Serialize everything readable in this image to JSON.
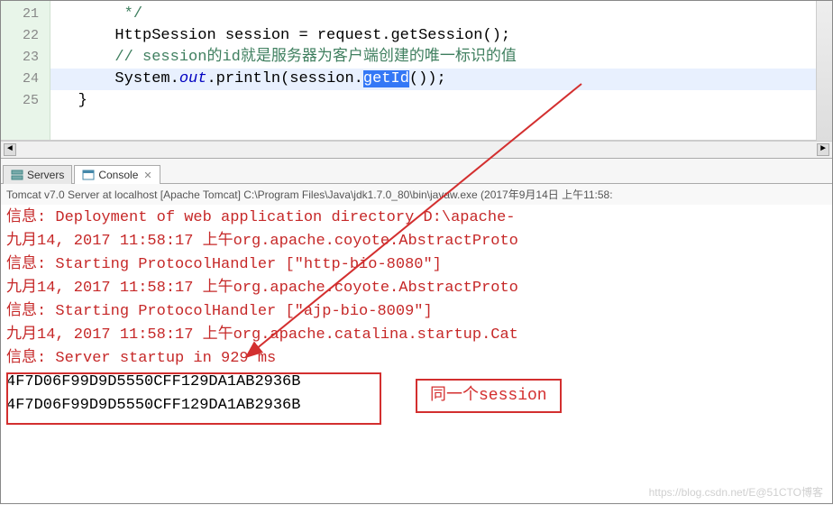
{
  "editor": {
    "lines": [
      {
        "num": "21",
        "content": "        */"
      },
      {
        "num": "22",
        "content": "       HttpSession session = request.getSession();"
      },
      {
        "num": "23",
        "content": "       // session的id就是服务器为客户端创建的唯一标识的值"
      },
      {
        "num": "24",
        "content": "       System.out.println(session.getId());"
      },
      {
        "num": "25",
        "content": "   }"
      }
    ],
    "code22": {
      "indent": "       ",
      "t1": "HttpSession session = request.getSession();"
    },
    "code23": {
      "indent": "       ",
      "comment": "// session的id就是服务器为客户端创建的唯一标识的值"
    },
    "code24": {
      "indent": "       ",
      "sys": "System.",
      "out": "out",
      "println": ".println(session.",
      "getId": "getId",
      "end": "());"
    },
    "code21": "        */",
    "code25": "   }"
  },
  "tabs": {
    "servers": "Servers",
    "console": "Console"
  },
  "consoleHeader": "Tomcat v7.0 Server at localhost [Apache Tomcat] C:\\Program Files\\Java\\jdk1.7.0_80\\bin\\javaw.exe (2017年9月14日 上午11:58:",
  "console": {
    "l1": "信息: Deployment of web application directory D:\\apache-",
    "l2": "九月14, 2017 11:58:17 上午org.apache.coyote.AbstractProto",
    "l3": "信息: Starting ProtocolHandler [\"http-bio-8080\"]",
    "l4": "九月14, 2017 11:58:17 上午org.apache.coyote.AbstractProto",
    "l5": "信息: Starting ProtocolHandler [\"ajp-bio-8009\"]",
    "l6": "九月14, 2017 11:58:17 上午org.apache.catalina.startup.Cat",
    "l7": "信息: Server startup in 929 ms",
    "l8": "4F7D06F99D9D5550CFF129DA1AB2936B",
    "l9": "4F7D06F99D9D5550CFF129DA1AB2936B"
  },
  "annotation": {
    "label": "同一个session"
  },
  "watermark": "https://blog.csdn.net/E@51CTO博客"
}
